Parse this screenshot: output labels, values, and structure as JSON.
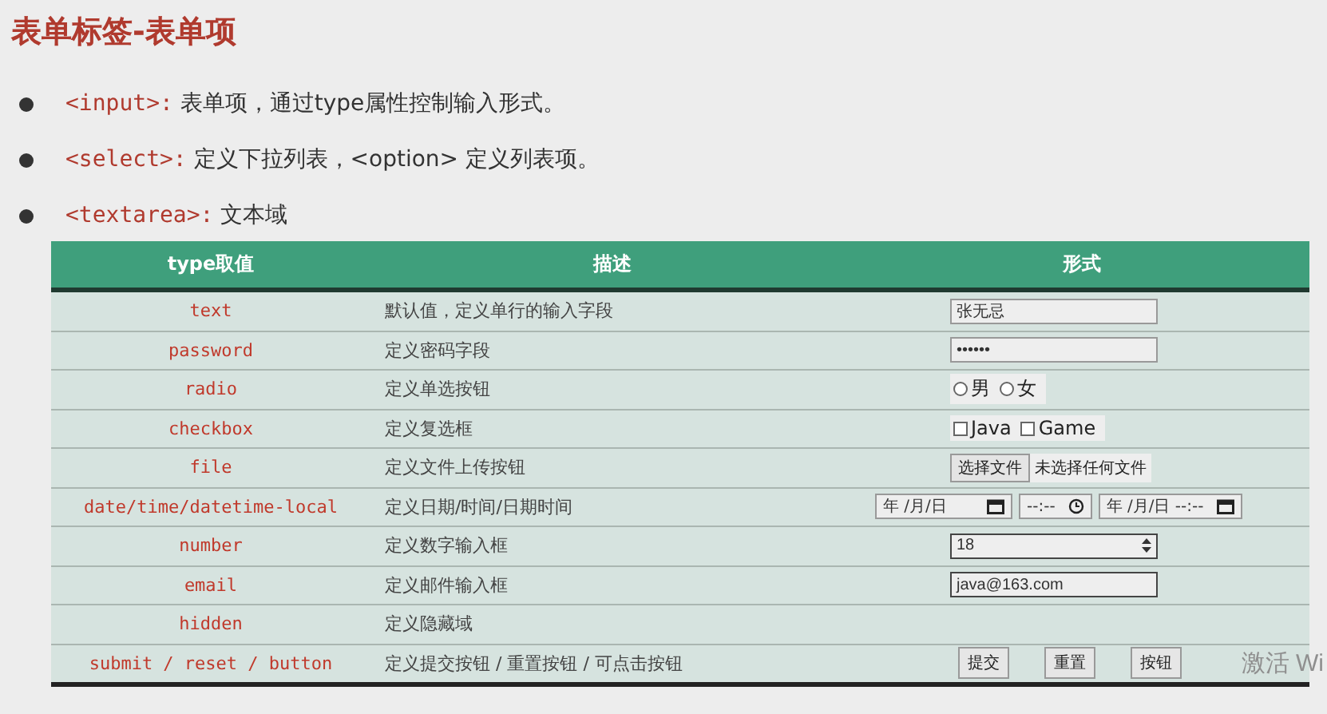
{
  "title": "表单标签-表单项",
  "bullets": [
    {
      "tag": "<input>:",
      "text": " 表单项，通过type属性控制输入形式。"
    },
    {
      "tag": "<select>:",
      "text": " 定义下拉列表，<option> 定义列表项。"
    },
    {
      "tag": "<textarea>:",
      "text": " 文本域"
    }
  ],
  "table": {
    "columns": [
      "type取值",
      "描述",
      "形式"
    ],
    "rows": [
      {
        "type": "text",
        "desc": "默认值，定义单行的输入字段",
        "form": {
          "kind": "text",
          "value": "张无忌"
        }
      },
      {
        "type": "password",
        "desc": "定义密码字段",
        "form": {
          "kind": "password",
          "value": "••••••"
        }
      },
      {
        "type": "radio",
        "desc": "定义单选按钮",
        "form": {
          "kind": "radio",
          "options": [
            {
              "label": "男",
              "selected": false
            },
            {
              "label": "女",
              "selected": false
            }
          ]
        }
      },
      {
        "type": "checkbox",
        "desc": "定义复选框",
        "form": {
          "kind": "checkbox",
          "options": [
            {
              "label": "Java",
              "checked": false
            },
            {
              "label": "Game",
              "checked": false
            }
          ]
        }
      },
      {
        "type": "file",
        "desc": "定义文件上传按钮",
        "form": {
          "kind": "file",
          "button": "选择文件",
          "status": "未选择任何文件"
        }
      },
      {
        "type": "date/time/datetime-local",
        "desc": "定义日期/时间/日期时间",
        "form": {
          "kind": "datetime",
          "fields": [
            {
              "kind": "date",
              "text": "年 /月/日"
            },
            {
              "kind": "time",
              "text": "--:--"
            },
            {
              "kind": "date",
              "text": "年 /月/日 --:--"
            }
          ]
        }
      },
      {
        "type": "number",
        "desc": "定义数字输入框",
        "form": {
          "kind": "number",
          "value": "18"
        }
      },
      {
        "type": "email",
        "desc": "定义邮件输入框",
        "form": {
          "kind": "email",
          "value": "java@163.com"
        }
      },
      {
        "type": "hidden",
        "desc": "定义隐藏域",
        "form": {
          "kind": "none"
        }
      },
      {
        "type": "submit / reset / button",
        "desc": "定义提交按钮 / 重置按钮 / 可点击按钮",
        "form": {
          "kind": "buttons",
          "labels": [
            "提交",
            "重置",
            "按钮"
          ]
        }
      }
    ]
  },
  "activation_notice": "激活 Wi"
}
